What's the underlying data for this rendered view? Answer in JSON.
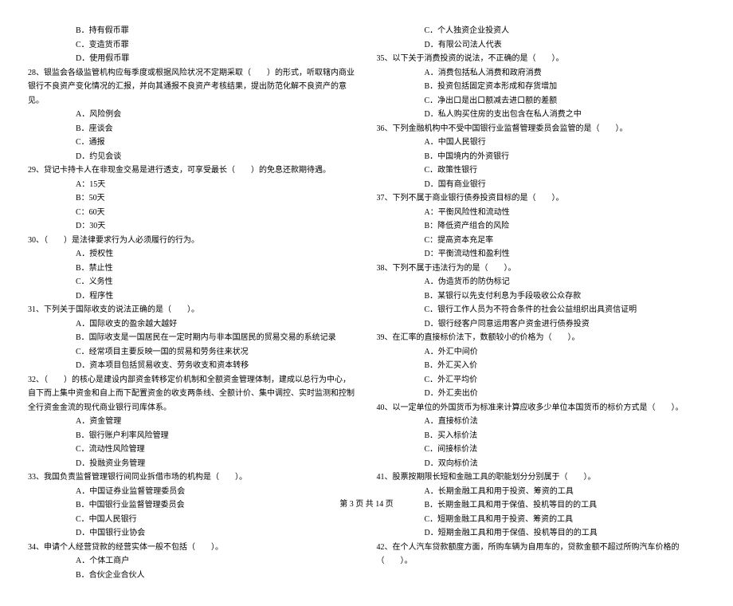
{
  "left": {
    "q27_opts": [
      "B．持有假币罪",
      "C．变造货币罪",
      "D．使用假币罪"
    ],
    "q28": "28、银监会各级监管机构应每季度或根据风险状况不定期采取（　　）的形式，听取辖内商业",
    "q28b": "银行不良资产变化情况的汇报，并向其通报不良资产考核结果，提出防范化解不良资产的意见。",
    "q28_opts": [
      "A．风险例会",
      "B．座谈会",
      "C．通报",
      "D．约见会谈"
    ],
    "q29": "29、贷记卡持卡人在非现金交易是进行透支，可享受最长（　　）的免息还款期待遇。",
    "q29_opts": [
      "A：15天",
      "B：50天",
      "C：60天",
      "D：30天"
    ],
    "q30": "30、（　　）是法律要求行为人必须履行的行为。",
    "q30_opts": [
      "A．授权性",
      "B．禁止性",
      "C．义务性",
      "D．程序性"
    ],
    "q31": "31、下列关于国际收支的说法正确的是（　　）。",
    "q31_opts": [
      "A．国际收支的盈余越大越好",
      "B．国际收支是一国居民在一定时期内与非本国居民的贸易交易的系统记录",
      "C．经常项目主要反映一国的贸易和劳务往来状况",
      "D．资本项目包括贸易收支、劳务收支和资本转移"
    ],
    "q32": "32、（　　）的核心是建设内部资金转移定价机制和全额资金管理体制，建成以总行为中心，",
    "q32b": "自下而上集中资金和自上而下配置资金的收支两条线、全额计价、集中调控、实时监测和控制",
    "q32c": "全行资金金流的现代商业银行司库体系。",
    "q32_opts": [
      "A．资金管理",
      "B．银行账户利率风险管理",
      "C．流动性风险管理",
      "D．投融资业务管理"
    ],
    "q33": "33、我国负责监督管理银行间同业拆借市场的机构是（　　）。",
    "q33_opts": [
      "A．中国证券业监督管理委员会",
      "B．中国银行业监督管理委员会",
      "C．中国人民银行",
      "D．中国银行业协会"
    ],
    "q34": "34、申请个人经营贷款的经营实体一般不包括（　　）。",
    "q34_opts": [
      "A．个体工商户",
      "B．合伙企业合伙人"
    ]
  },
  "right": {
    "q34_opts2": [
      "C．个人独资企业投资人",
      "D．有限公司法人代表"
    ],
    "q35": "35、以下关于消费投资的说法，不正确的是（　　）。",
    "q35_opts": [
      "A．消费包括私人消费和政府消费",
      "B．投资包括固定资本形成和存货增加",
      "C．净出口是出口额减去进口额的差额",
      "D．私人购买住房的支出包含在私人消费之中"
    ],
    "q36": "36、下列金融机构中不受中国银行业监督管理委员会监管的是（　　）。",
    "q36_opts": [
      "A．中国人民银行",
      "B．中国境内的外资银行",
      "C．政策性银行",
      "D．国有商业银行"
    ],
    "q37": "37、下列不属于商业银行债券投资目标的是（　　）。",
    "q37_opts": [
      "A：平衡风险性和流动性",
      "B：降低资产组合的风险",
      "C：提高资本充足率",
      "D：平衡流动性和盈利性"
    ],
    "q38": "38、下列不属于违法行为的是（　　）。",
    "q38_opts": [
      "A．伪造货币的防伪标记",
      "B．某银行以先支付利息为手段吸收公众存款",
      "C．银行工作人员为不符合条件的社会公益组织出具资信证明",
      "D．银行经客户同意运用客户资金进行债券投资"
    ],
    "q39": "39、在汇率的直接标价法下，数额较小的价格为（　　）。",
    "q39_opts": [
      "A．外汇中间价",
      "B．外汇买入价",
      "C．外汇平均价",
      "D．外汇卖出价"
    ],
    "q40": "40、以一定单位的外国货币为标准来计算应收多少单位本国货币的标价方式是（　　）。",
    "q40_opts": [
      "A．直接标价法",
      "B．买入标价法",
      "C．间接标价法",
      "D．双向标价法"
    ],
    "q41": "41、股票按期限长短和金融工具的职能划分分别属于（　　）。",
    "q41_opts": [
      "A．长期金融工具和用于投资、筹资的工具",
      "B．长期金融工具和用于保值、投机等目的的工具",
      "C．短期金融工具和用于投资、筹资的工具",
      "D．短期金融工具和用于保值、投机等目的的工具"
    ],
    "q42": "42、在个人汽车贷款额度方面，所购车辆为自用车的，贷款金额不超过所购汽车价格的",
    "q42b": "（　　）。"
  },
  "footer": "第 3 页 共 14 页"
}
